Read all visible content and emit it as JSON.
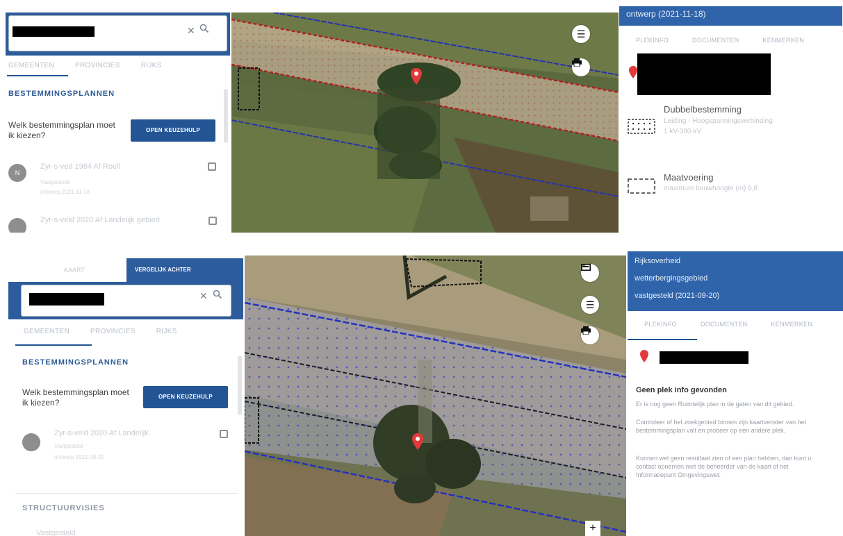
{
  "top": {
    "sidebar": {
      "tabs": [
        "GEMEENTEN",
        "PROVINCIES",
        "RIJKS"
      ],
      "section_title": "BESTEMMINGSPLANNEN",
      "question": "Welk bestemmingsplan moet ik kiezen?",
      "open_button": "OPEN KEUZEHULP",
      "plans": [
        {
          "avatar": "N",
          "title": "Zyr-s-ved 1984 Af Roell",
          "sub1": "Vastgesteld",
          "sub2": "ontwerp 2021-11-18"
        },
        {
          "avatar": "",
          "title": "Zyr-s-veld 2020 Af Landelijk gebied",
          "sub1": "",
          "sub2": ""
        }
      ]
    },
    "right_panel": {
      "header": "ontwerp (2021-11-18)",
      "tabs": [
        "PLEKINFO",
        "DOCUMENTEN",
        "KENMERKEN"
      ],
      "legend": [
        {
          "label": "Dubbelbestemming",
          "sub1": "Leiding - Hoogspanningsverbinding",
          "sub2": "1 kV-380 kV"
        },
        {
          "label": "Maatvoering",
          "sub1": "maximum bouwhoogte (m) 6,8",
          "sub2": ""
        }
      ]
    }
  },
  "bottom": {
    "sidebar": {
      "top_tabs": [
        "KAART",
        "VERGELIJK ACHTER"
      ],
      "tabs": [
        "GEMEENTEN",
        "PROVINCIES",
        "RIJKS"
      ],
      "section_title": "BESTEMMINGSPLANNEN",
      "question": "Welk bestemmingsplan moet ik kiezen?",
      "open_button": "OPEN KEUZEHULP",
      "plans": [
        {
          "avatar": "",
          "title": "Zyr-s-veld 2020 Af Landelijk",
          "sub1": "Vastgesteld",
          "sub2": "ontwerp 2021-09-20"
        }
      ],
      "structure_title": "STRUCTUURVISIES",
      "structure_item": "Vastgesteld"
    },
    "right_panel": {
      "header_lines": [
        "Rijksoverheid",
        "wetterbergingsgebied",
        "vastgesteld (2021-09-20)"
      ],
      "tabs": [
        "PLEKINFO",
        "DOCUMENTEN",
        "KENMERKEN"
      ],
      "info_title": "Geen plek info gevonden",
      "info_paragraphs": [
        "Er is nog geen Ruimtelijk plan in de gaten van dit gebied.",
        "Controleer of het zoekgebied binnen zijn kaartvenster van het bestemmingsplan valt en probeer op een andere plek.",
        "Kunnen wel geen resultaat zien of een plan hebben, dan kunt u contact opnemen met de beheerder van de kaart of het Informatiepunt Omgevingswet."
      ]
    }
  },
  "colors": {
    "brand_blue": "#235594",
    "header_blue": "#2f64aa",
    "pin_red": "#e23a3a"
  }
}
